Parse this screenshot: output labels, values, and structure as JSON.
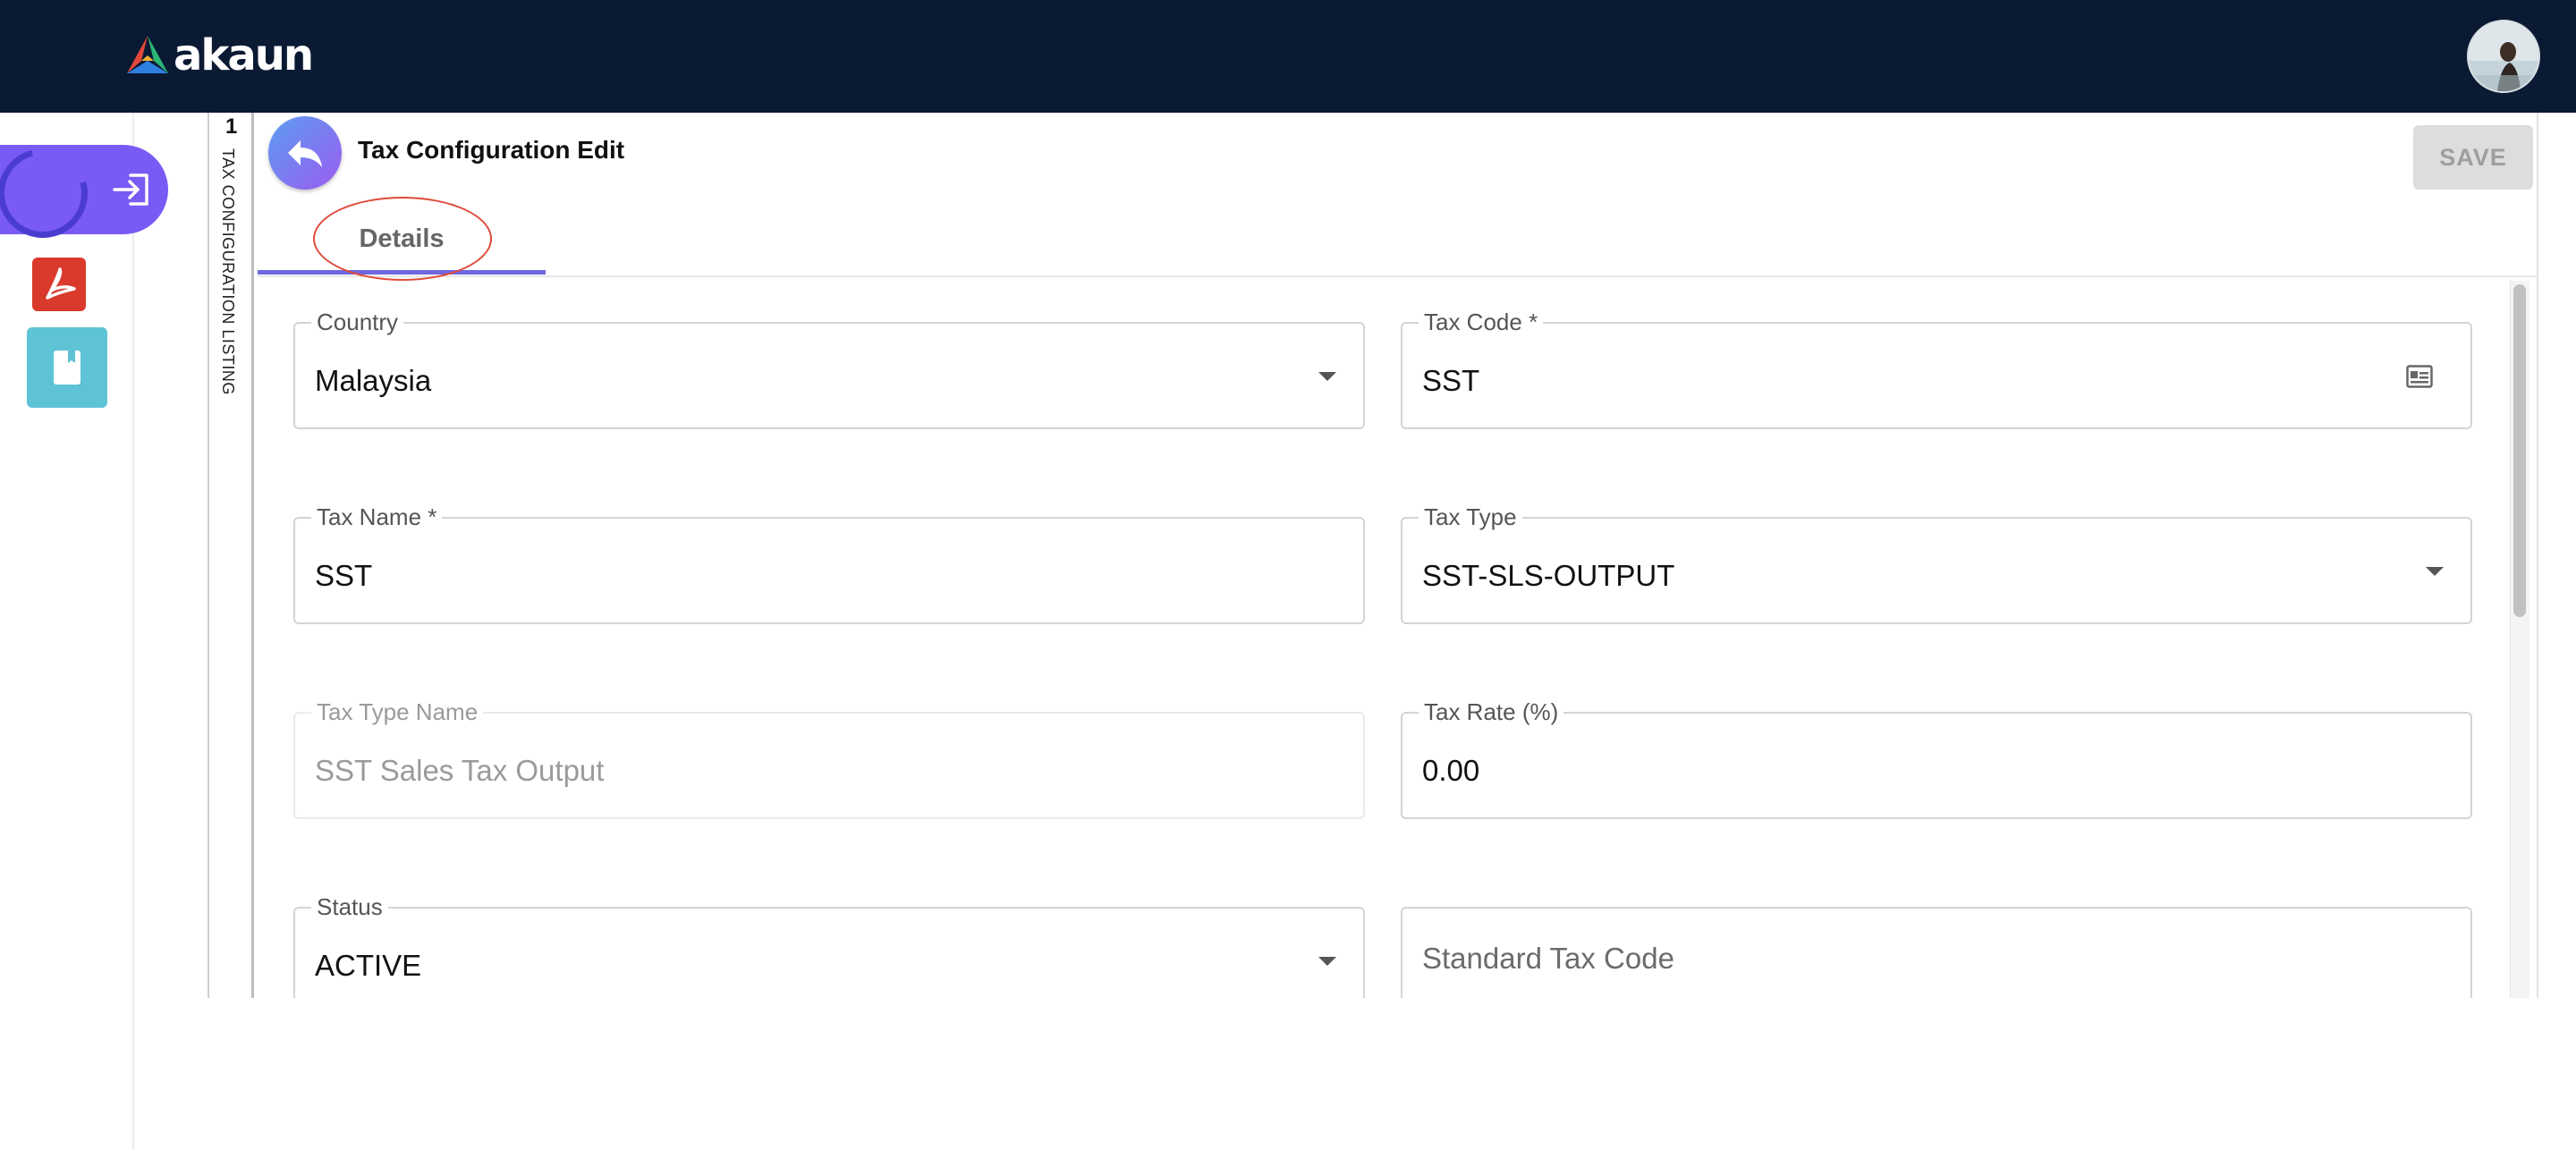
{
  "app": {
    "brand": "akaun",
    "colors": {
      "topbar": "#0b1a33",
      "accent": "#6f67e0",
      "save_disabled": "#dddddd"
    }
  },
  "rail": {
    "items": [
      {
        "icon": "login-icon"
      },
      {
        "icon": "acrobat-icon"
      },
      {
        "icon": "book-icon"
      }
    ]
  },
  "listing": {
    "count": "1",
    "label": "TAX CONFIGURATION LISTING"
  },
  "header": {
    "title": "Tax Configuration Edit",
    "save_label": "SAVE"
  },
  "tabs": [
    {
      "label": "Details",
      "active": true
    }
  ],
  "form": {
    "country": {
      "label": "Country",
      "value": "Malaysia"
    },
    "tax_code": {
      "label": "Tax Code *",
      "value": "SST"
    },
    "tax_name": {
      "label": "Tax Name *",
      "value": "SST"
    },
    "tax_type": {
      "label": "Tax Type",
      "value": "SST-SLS-OUTPUT"
    },
    "tax_type_name": {
      "label": "Tax Type Name",
      "value": "SST Sales Tax Output"
    },
    "tax_rate": {
      "label": "Tax Rate (%)",
      "value": "0.00"
    },
    "status": {
      "label": "Status",
      "value": "ACTIVE"
    },
    "standard_tax_code": {
      "placeholder": "Standard Tax Code"
    }
  }
}
